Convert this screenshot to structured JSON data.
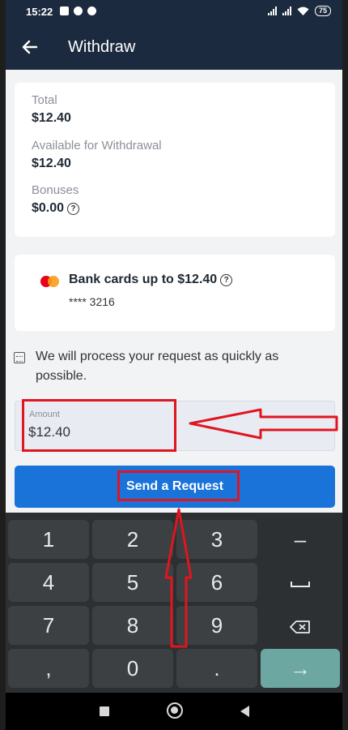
{
  "status_bar": {
    "time": "15:22",
    "battery": "75"
  },
  "app_bar": {
    "title": "Withdraw",
    "back_icon": "arrow-left-icon"
  },
  "balance": {
    "total_label": "Total",
    "total_value": "$12.40",
    "available_label": "Available for Withdrawal",
    "available_value": "$12.40",
    "bonuses_label": "Bonuses",
    "bonuses_value": "$0.00",
    "help_glyph": "?"
  },
  "payment_method": {
    "icon": "mastercard-icon",
    "title": "Bank cards up to $12.40",
    "card_number": "**** 3216",
    "help_glyph": "?"
  },
  "info": {
    "icon": "calendar-icon",
    "text": "We will process your request as quickly as possible."
  },
  "amount_field": {
    "label": "Amount",
    "value": "$12.40"
  },
  "send_button": {
    "label": "Send a Request"
  },
  "keyboard": {
    "rows": [
      [
        "1",
        "2",
        "3",
        "–"
      ],
      [
        "4",
        "5",
        "6",
        "space"
      ],
      [
        "7",
        "8",
        "9",
        "backspace"
      ],
      [
        ",",
        "0",
        ".",
        "enter"
      ]
    ],
    "keys": {
      "k1": "1",
      "k2": "2",
      "k3": "3",
      "minus": "–",
      "k4": "4",
      "k5": "5",
      "k6": "6",
      "k7": "7",
      "k8": "8",
      "k9": "9",
      "comma": ",",
      "k0": "0",
      "dot": ".",
      "enter": "→"
    }
  },
  "colors": {
    "header": "#1c2a3f",
    "primary_button": "#1a73d9",
    "annotation": "#e0151f",
    "enter_key": "#6da7a2"
  }
}
